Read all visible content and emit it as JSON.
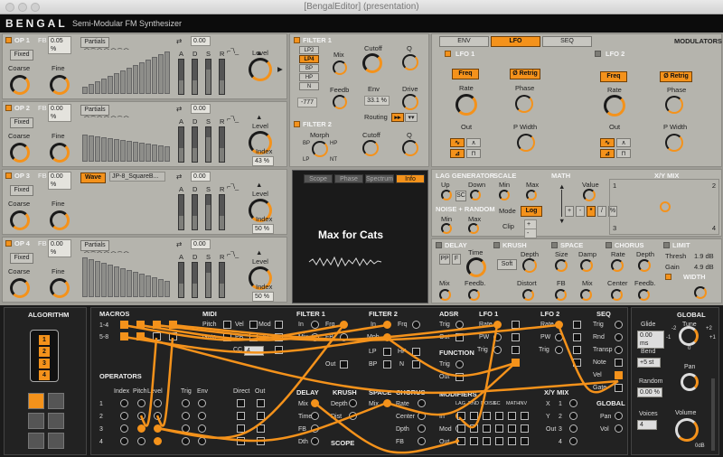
{
  "window": {
    "title": "[BengalEditor] (presentation)"
  },
  "header": {
    "brand": "BENGAL",
    "subtitle": "Semi-Modular FM Synthesizer"
  },
  "operators": [
    {
      "name": "OP 1",
      "fb": "FB",
      "fb_value": "0.05 %",
      "mode": "Fixed",
      "coarse": "Coarse",
      "fine": "Fine",
      "wave": "Partials",
      "level": "Level",
      "index": "",
      "loop": "0.00"
    },
    {
      "name": "OP 2",
      "fb": "FB",
      "fb_value": "0.00 %",
      "mode": "Fixed",
      "coarse": "Coarse",
      "fine": "Fine",
      "wave": "Partials",
      "level": "Level",
      "index": "Index",
      "index_value": "43 %",
      "loop": "0.00"
    },
    {
      "name": "OP 3",
      "fb": "FB",
      "fb_value": "0.00 %",
      "mode": "Fixed",
      "coarse": "Coarse",
      "fine": "Fine",
      "wave": "Wave",
      "wave_select": "JP-8_SquareB...",
      "level": "Level",
      "index": "Index",
      "index_value": "50 %",
      "loop": "0.00"
    },
    {
      "name": "OP 4",
      "fb": "FB",
      "fb_value": "0.00 %",
      "mode": "Fixed",
      "coarse": "Coarse",
      "fine": "Fine",
      "wave": "Partials",
      "level": "Level",
      "index": "Index",
      "index_value": "50 %",
      "loop": "0.00"
    }
  ],
  "adsr": [
    "A",
    "D",
    "S",
    "R"
  ],
  "filter1": {
    "title": "FILTER 1",
    "types": [
      "LP2",
      "LP4",
      "BP",
      "HP",
      "N"
    ],
    "mix": "Mix",
    "cutoff": "Cutoff",
    "q": "Q",
    "feedb": "Feedb",
    "env": "Env",
    "env_value": "33.1 %",
    "drive": "Drive",
    "routing": "Routing",
    "fb_value": "-777"
  },
  "filter2": {
    "title": "FILTER 2",
    "morph": "Morph",
    "cutoff": "Cutoff",
    "q": "Q",
    "bp": "BP",
    "hp": "HP",
    "lp": "LP",
    "nt": "NT"
  },
  "scope": {
    "tabs": [
      "Scope",
      "Phase",
      "Spectrum",
      "Info"
    ],
    "title": "Max for Cats"
  },
  "modulators": {
    "label": "MODULATORS",
    "tabs": [
      "ENV",
      "LFO",
      "SEQ"
    ],
    "lfo1": {
      "title": "LFO 1",
      "freq": "Freq",
      "retrig": "Ø Retrig",
      "rate": "Rate",
      "phase": "Phase",
      "out": "Out",
      "pwidth": "P Width"
    },
    "lfo2": {
      "title": "LFO 2",
      "freq": "Freq",
      "retrig": "Ø Retrig",
      "rate": "Rate",
      "phase": "Phase",
      "out": "Out",
      "pwidth": "P Width"
    }
  },
  "lag": {
    "title": "LAG GENERATOR",
    "up": "Up",
    "down": "Down",
    "sc": "SC"
  },
  "scale": {
    "title": "SCALE",
    "min": "Min",
    "max": "Max",
    "mode": "Mode",
    "log": "Log",
    "clip": "Clip"
  },
  "noise": {
    "title": "NOISE + RANDOM",
    "min": "Min",
    "max": "Max"
  },
  "math": {
    "title": "MATH",
    "value": "Value",
    "ops": [
      "+",
      "-",
      "*",
      "/",
      "%"
    ]
  },
  "xymix": {
    "title": "X/Y MIX",
    "c1": "1",
    "c2": "2",
    "c3": "3",
    "c4": "4"
  },
  "delay": {
    "title": "DELAY",
    "time": "Time",
    "mix": "Mix",
    "feedb": "Feedb.",
    "pp": "PP",
    "f": "F"
  },
  "krush": {
    "title": "KRUSH",
    "depth": "Depth",
    "soft": "Soft",
    "distort": "Distort"
  },
  "space": {
    "title": "SPACE",
    "size": "Size",
    "damp": "Damp",
    "fb": "FB",
    "mix": "Mix"
  },
  "chorus": {
    "title": "CHORUS",
    "rate": "Rate",
    "depth": "Depth",
    "center": "Center",
    "feedb": "Feedb."
  },
  "limit": {
    "title": "LIMIT",
    "thresh": "Thresh",
    "thresh_value": "1.9 dB",
    "gain": "Gain",
    "gain_value": "4.9 dB",
    "width": "WIDTH"
  },
  "matrix": {
    "algorithm": "ALGORITHM",
    "algo_steps": [
      "1",
      "2",
      "3",
      "4"
    ],
    "macros": "MACROS",
    "macro_rows": [
      "1-4",
      "5-8"
    ],
    "operators": "OPERATORS",
    "op_cols": [
      "Index",
      "Pitch",
      "Level",
      "Trig",
      "Env",
      "Direct",
      "Out"
    ],
    "op_rows": [
      "1",
      "2",
      "3",
      "4"
    ],
    "midi": "MIDI",
    "midi_items": [
      "Pitch",
      "Vel",
      "Mod",
      "Gate",
      "PB",
      "AT",
      "CC"
    ],
    "cc_value": "4",
    "filter1": "FILTER 1",
    "f1_items": [
      "In",
      "Frq",
      "Mix",
      "FB",
      "Out"
    ],
    "filter2": "FILTER 2",
    "f2_items": [
      "In",
      "Frq",
      "Mph",
      "LP",
      "HP",
      "BP",
      "N",
      "Out"
    ],
    "adsr": "ADSR",
    "adsr_items": [
      "Trig",
      "Out"
    ],
    "function": "FUNCTION",
    "function_items": [
      "Trig",
      "Out"
    ],
    "lfo1": "LFO 1",
    "lfo1_items": [
      "Rate",
      "PW",
      "Trig"
    ],
    "lfo2": "LFO 2",
    "lfo2_items": [
      "Rate",
      "PW",
      "Trig"
    ],
    "seq": "SEQ",
    "seq_items": [
      "Trig",
      "Rnd",
      "Transp",
      "Note",
      "Vel",
      "Gate"
    ],
    "delay": "DELAY",
    "delay_items": [
      "Mix",
      "Time",
      "FB",
      "Dth"
    ],
    "krush": "KRUSH",
    "krush_items": [
      "Depth",
      "Dist"
    ],
    "space": "SPACE",
    "space_items": [
      "Mix"
    ],
    "chorus": "CHORUS",
    "chorus_items": [
      "Rate",
      "Center",
      "Dpth",
      "FB"
    ],
    "scope": "SCOPE",
    "modifiers": "MODIFIERS",
    "mod_items": [
      "In",
      "Mod",
      "Out"
    ],
    "mod_cols": [
      "LAG",
      "RND",
      "NOISE",
      "SC",
      "MATH",
      "INV"
    ],
    "xymix": "X/Y MIX",
    "xy_items": [
      "X",
      "Y",
      "Out"
    ],
    "xy_cols": [
      "1",
      "2",
      "3",
      "4"
    ],
    "global_mid": "GLOBAL",
    "global_items": [
      "Pan",
      "Vol"
    ]
  },
  "global": {
    "title": "GLOBAL",
    "glide": "Glide",
    "glide_value": "0.00 ms",
    "tune": "Tune",
    "tune_marks": [
      "-2",
      "+2",
      "-1",
      "+1",
      "0"
    ],
    "bend": "Bend",
    "bend_value": "+5 st",
    "pan": "Pan",
    "random": "Random",
    "random_value": "0.00 %",
    "voices": "Voices",
    "voices_value": "4",
    "volume": "Volume",
    "volume_value": "0dB"
  }
}
